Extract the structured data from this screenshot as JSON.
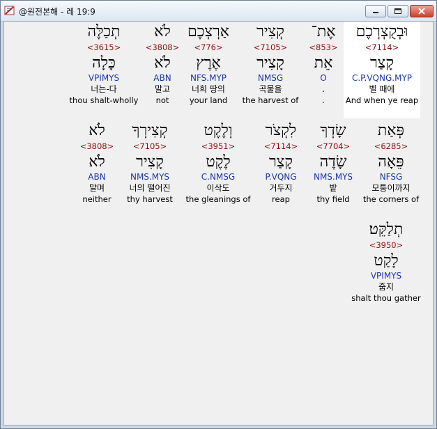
{
  "window": {
    "title": "@원전본해 - 레 19:9",
    "icon": "bible-app-icon",
    "buttons": [
      "minimize-icon",
      "maximize-icon",
      "close-icon"
    ]
  },
  "words": [
    {
      "heb": "וּבְקֻצְרְכֶם",
      "strong": "<7114>",
      "lemma": "קָצַר",
      "morph": "C.P.VQNG.MYP",
      "korean": "벨 때에",
      "english": "And when ye reap"
    },
    {
      "heb": "אֶת־",
      "strong": "<853>",
      "lemma": "אֵת",
      "morph": "O",
      "korean": ".",
      "english": "."
    },
    {
      "heb": "קְצִיר",
      "strong": "<7105>",
      "lemma": "קָצִיר",
      "morph": "NMSG",
      "korean": "곡물을",
      "english": "the harvest of"
    },
    {
      "heb": "אַרְצְכֶם",
      "strong": "<776>",
      "lemma": "אֶרֶץ",
      "morph": "NFS.MYP",
      "korean": "너희 땅의",
      "english": "your land"
    },
    {
      "heb": "לֹא",
      "strong": "<3808>",
      "lemma": "לֹא",
      "morph": "ABN",
      "korean": "말고",
      "english": "not"
    },
    {
      "heb": "תְכַלֶּה",
      "strong": "<3615>",
      "lemma": "כָּלָה",
      "morph": "VPIMYS",
      "korean": "너는-다",
      "english": "thou shalt-wholly"
    },
    {
      "heb": "פְּאַת",
      "strong": "<6285>",
      "lemma": "פֵּאָה",
      "morph": "NFSG",
      "korean": "모퉁이까지",
      "english": "the corners of"
    },
    {
      "heb": "שָׂדְךָ",
      "strong": "<7704>",
      "lemma": "שָׂדֶה",
      "morph": "NMS.MYS",
      "korean": "밭",
      "english": "thy field"
    },
    {
      "heb": "לִקְצֹר",
      "strong": "<7114>",
      "lemma": "קָצַר",
      "morph": "P.VQNG",
      "korean": "거두지",
      "english": "reap"
    },
    {
      "heb": "וְלֶקֶט",
      "strong": "<3951>",
      "lemma": "לֶקֶט",
      "morph": "C.NMSG",
      "korean": "이삭도",
      "english": "the gleanings of"
    },
    {
      "heb": "קְצִירְךָ",
      "strong": "<7105>",
      "lemma": "קָצִיר",
      "morph": "NMS.MYS",
      "korean": "너의 떨어진",
      "english": "thy harvest"
    },
    {
      "heb": "לֹא",
      "strong": "<3808>",
      "lemma": "לֹא",
      "morph": "ABN",
      "korean": "말며",
      "english": "neither"
    },
    {
      "heb": "תְלַקֵּט׃",
      "strong": "<3950>",
      "lemma": "לָקַט",
      "morph": "VPIMYS",
      "korean": "줍지",
      "english": "shalt thou gather"
    }
  ]
}
